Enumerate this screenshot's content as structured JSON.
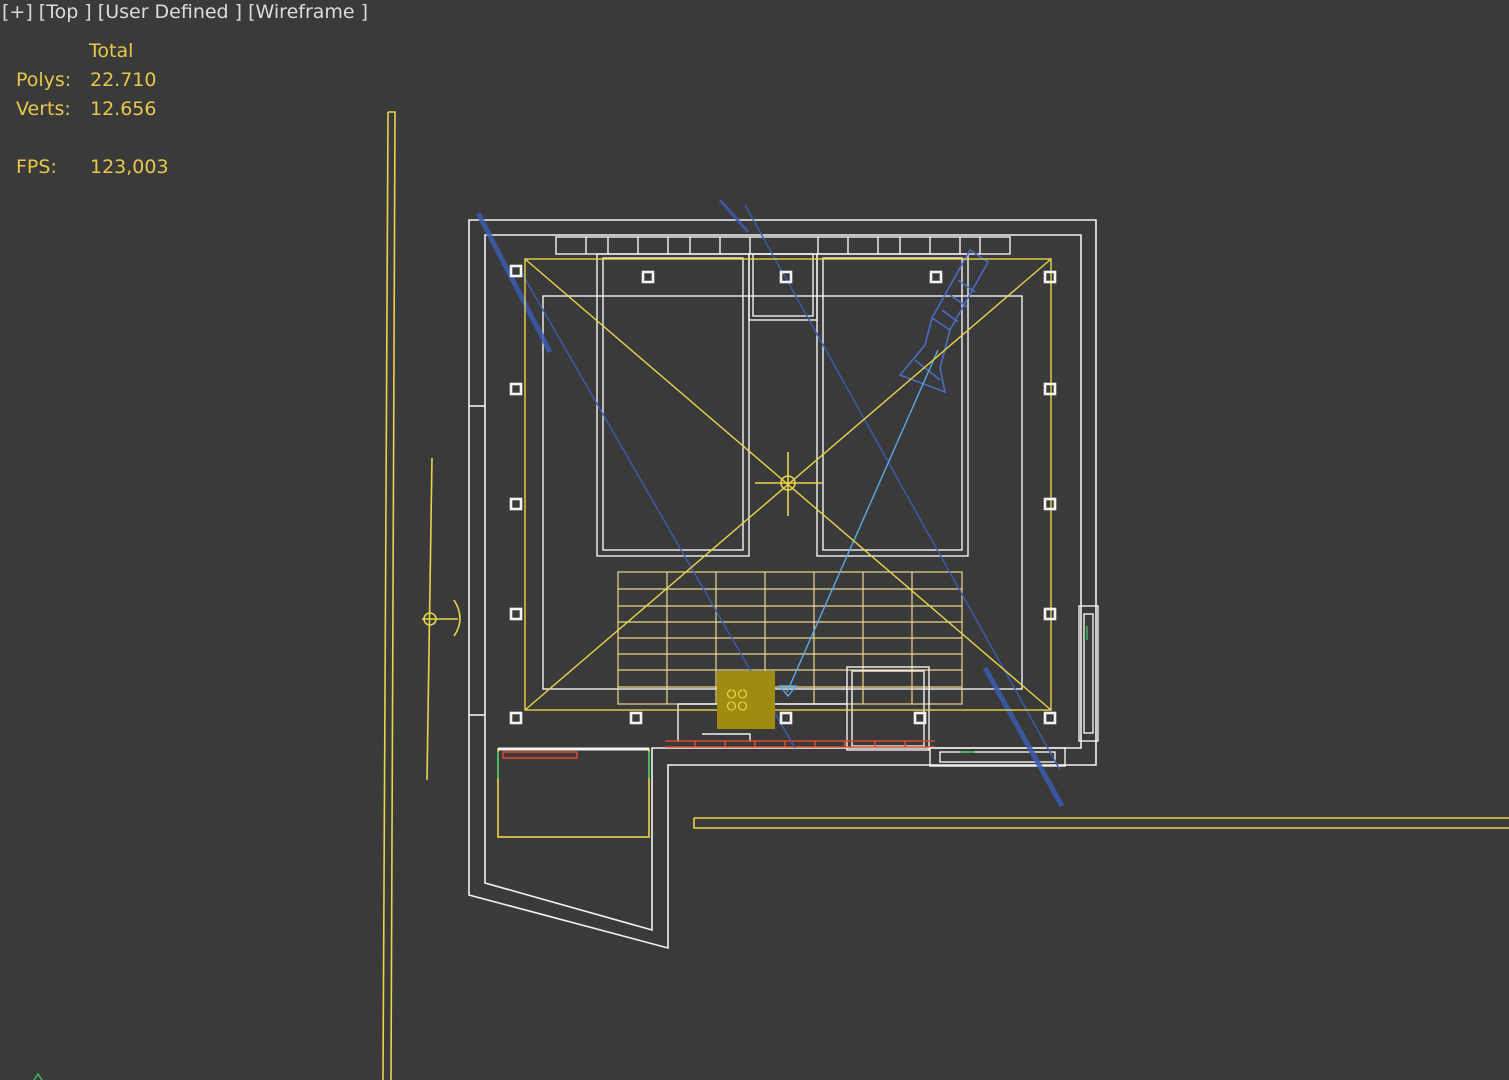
{
  "viewport": {
    "plus": "[+]",
    "view": "[Top ]",
    "camera": "[User Defined ]",
    "shading": "[Wireframe ]"
  },
  "stats": {
    "header": "Total",
    "polys_label": "Polys:",
    "polys_value": "22.710",
    "verts_label": "Verts:",
    "verts_value": "12.656",
    "fps_label": "FPS:",
    "fps_value": "123,003"
  },
  "colors": {
    "background": "#3a3a3a",
    "stats_text": "#e8c84a",
    "label_text": "#dcdcdc",
    "wire_white": "#f2f2f2",
    "wire_yellow": "#e6d44a",
    "wire_blue": "#4a6cc4",
    "wire_cyan": "#5aa8e6",
    "selection": "#a08a10",
    "accent_red": "#d84a2a",
    "accent_green": "#3ac060"
  },
  "scene": {
    "objects": [
      "room-walls",
      "ceiling-lights",
      "beds",
      "rug-grid",
      "area-light",
      "target-camera",
      "balcony",
      "window"
    ]
  }
}
